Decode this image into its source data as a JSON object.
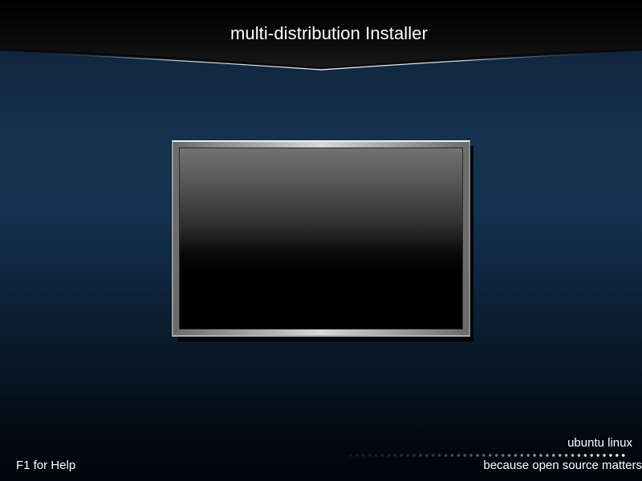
{
  "header": {
    "title": "multi-distribution Installer"
  },
  "footer": {
    "help_text": "F1 for Help",
    "brand_text": "ubuntu linux",
    "tagline_text": "because open source matters"
  },
  "colors": {
    "background_top": "#16324f",
    "background_bottom": "#01050a",
    "header_bar": "#000000",
    "text": "#ffffff"
  }
}
